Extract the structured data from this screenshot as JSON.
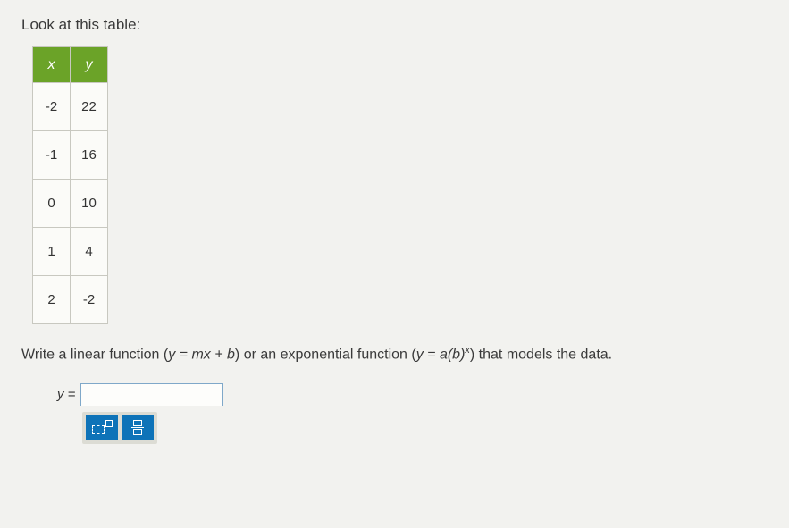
{
  "instruction": "Look at this table:",
  "table": {
    "headers": {
      "x": "x",
      "y": "y"
    },
    "rows": [
      {
        "x": "-2",
        "y": "22"
      },
      {
        "x": "-1",
        "y": "16"
      },
      {
        "x": "0",
        "y": "10"
      },
      {
        "x": "1",
        "y": "4"
      },
      {
        "x": "2",
        "y": "-2"
      }
    ]
  },
  "question": {
    "prefix": "Write a linear function (",
    "linear": "y = mx + b",
    "middle": ") or an exponential function (",
    "exp_base": "y = a(b)",
    "exp_sup": "x",
    "suffix": ") that models the data."
  },
  "answer": {
    "label": "y =",
    "value": ""
  },
  "tools": {
    "exponent": "exponent-tool",
    "fraction": "fraction-tool"
  }
}
